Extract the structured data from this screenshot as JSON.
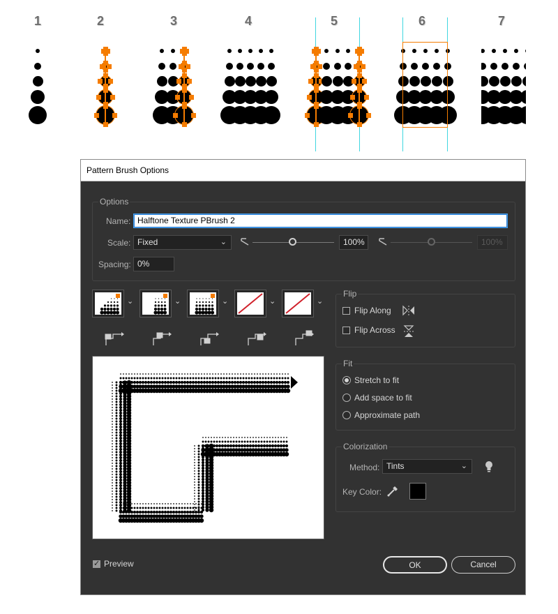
{
  "steps": [
    "1",
    "2",
    "3",
    "4",
    "5",
    "6",
    "7"
  ],
  "dialog": {
    "title": "Pattern Brush Options",
    "options_group": "Options",
    "name_label": "Name:",
    "name_value": "Halftone Texture PBrush 2",
    "scale_label": "Scale:",
    "scale_value": "Fixed",
    "scale_percent": "100%",
    "scale_percent_disabled": "100%",
    "spacing_label": "Spacing:",
    "spacing_value": "0%",
    "flip_group": "Flip",
    "flip_along": "Flip Along",
    "flip_across": "Flip Across",
    "fit_group": "Fit",
    "fit_options": [
      "Stretch to fit",
      "Add space to fit",
      "Approximate path"
    ],
    "fit_selected": 0,
    "colorization_group": "Colorization",
    "method_label": "Method:",
    "method_value": "Tints",
    "key_color_label": "Key Color:",
    "key_color": "#000000",
    "preview_label": "Preview",
    "preview_checked": true,
    "ok_label": "OK",
    "cancel_label": "Cancel"
  },
  "colors": {
    "selection": "#f57c00",
    "guide": "#3fd6e0",
    "dialog_bg": "#323232"
  },
  "tile_icons": [
    "side-tile-icon",
    "outer-corner-tile-icon",
    "inner-corner-tile-icon",
    "start-tile-icon",
    "end-tile-icon"
  ]
}
